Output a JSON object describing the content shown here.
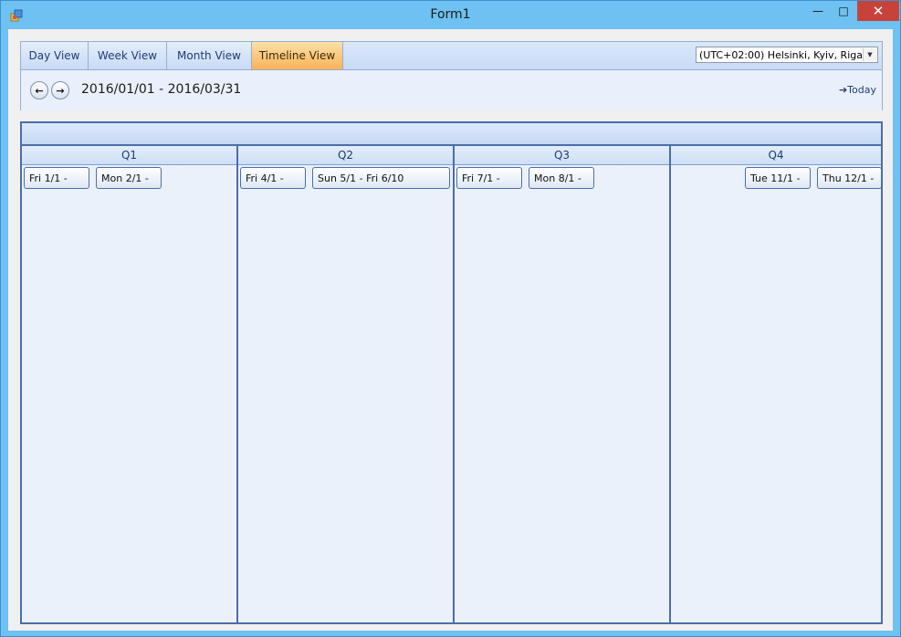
{
  "window": {
    "title": "Form1",
    "minimize": "—",
    "maximize": "□",
    "close": "✕"
  },
  "toolbar": {
    "tabs": [
      {
        "label": "Day View"
      },
      {
        "label": "Week View"
      },
      {
        "label": "Month View"
      },
      {
        "label": "Timeline View"
      }
    ],
    "active_tab": "Timeline View",
    "timezone": "(UTC+02:00) Helsinki, Kyiv, Riga,",
    "prev_icon": "←",
    "next_icon": "→",
    "date_range": "2016/01/01 - 2016/03/31",
    "today_label": "➔Today"
  },
  "timeline": {
    "quarters": [
      {
        "label": "Q1",
        "appointments": [
          {
            "text": "Fri 1/1 -"
          },
          {
            "text": "Mon 2/1 -"
          }
        ]
      },
      {
        "label": "Q2",
        "appointments": [
          {
            "text": "Fri 4/1 -"
          },
          {
            "text": "Sun 5/1 - Fri 6/10"
          }
        ]
      },
      {
        "label": "Q3",
        "appointments": [
          {
            "text": "Fri 7/1 -"
          },
          {
            "text": "Mon 8/1 -"
          }
        ]
      },
      {
        "label": "Q4",
        "appointments": [
          {
            "text": "Tue 11/1 -"
          },
          {
            "text": "Thu 12/1 -"
          }
        ]
      }
    ]
  },
  "colors": {
    "active_tab": "#f9b357",
    "border": "#4a6ea9",
    "close_button": "#c7433a"
  }
}
